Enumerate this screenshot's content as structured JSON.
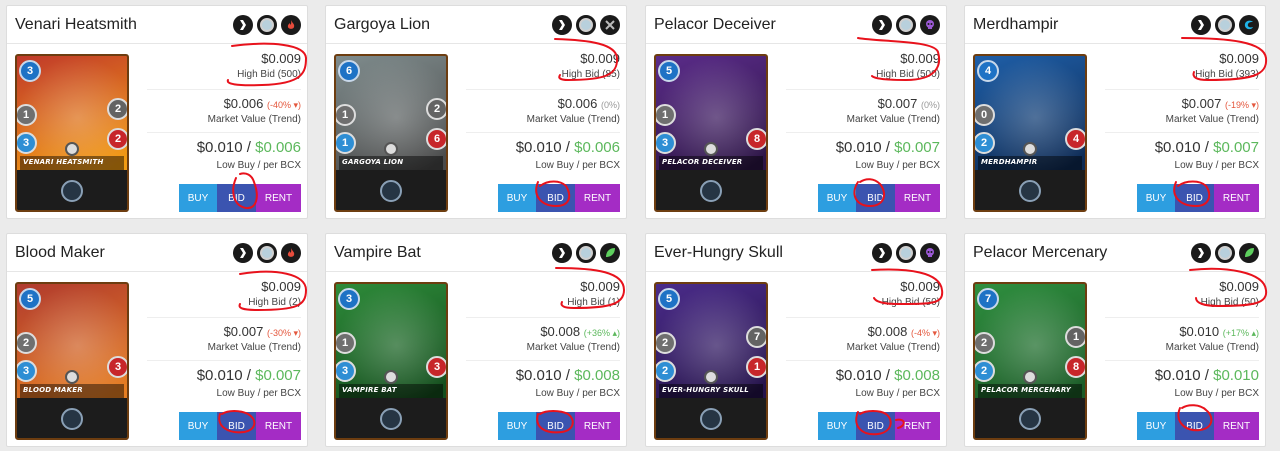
{
  "cards": [
    {
      "name": "Venari Heatsmith",
      "element": "fire",
      "mana": "3",
      "left_stat": "1",
      "speed": "3",
      "armor": "2",
      "health": "2",
      "art_colors": [
        "#c0392b",
        "#f39c12"
      ],
      "high_bid_price": "$0.009",
      "high_bid_label": "High Bid (500)",
      "market_price": "$0.006",
      "market_change": "(-40% ▾)",
      "market_change_type": "neg",
      "market_label": "Market Value (Trend)",
      "low_buy": "$0.010",
      "per_bcx": "$0.006",
      "low_buy_label": "Low Buy / per BCX",
      "buy": "BUY",
      "bid": "BID",
      "rent": "RENT"
    },
    {
      "name": "Gargoya Lion",
      "element": "neutral",
      "mana": "6",
      "left_stat": "1",
      "speed": "1",
      "armor": "2",
      "health": "6",
      "art_colors": [
        "#7f8c8d",
        "#4a4a4a"
      ],
      "high_bid_price": "$0.009",
      "high_bid_label": "High Bid (85)",
      "market_price": "$0.006",
      "market_change": "(0%)",
      "market_change_type": "zero",
      "market_label": "Market Value (Trend)",
      "low_buy": "$0.010",
      "per_bcx": "$0.006",
      "low_buy_label": "Low Buy / per BCX",
      "buy": "BUY",
      "bid": "BID",
      "rent": "RENT"
    },
    {
      "name": "Pelacor Deceiver",
      "element": "death",
      "mana": "5",
      "left_stat": "1",
      "speed": "3",
      "armor": "",
      "health": "8",
      "art_colors": [
        "#5b2c8a",
        "#2c1445"
      ],
      "high_bid_price": "$0.009",
      "high_bid_label": "High Bid (500)",
      "market_price": "$0.007",
      "market_change": "(0%)",
      "market_change_type": "zero",
      "market_label": "Market Value (Trend)",
      "low_buy": "$0.010",
      "per_bcx": "$0.007",
      "low_buy_label": "Low Buy / per BCX",
      "buy": "BUY",
      "bid": "BID",
      "rent": "RENT"
    },
    {
      "name": "Merdhampir",
      "element": "water",
      "mana": "4",
      "left_stat": "0",
      "speed": "2",
      "armor": "",
      "health": "4",
      "art_colors": [
        "#1f5fa8",
        "#0d2a54"
      ],
      "high_bid_price": "$0.009",
      "high_bid_label": "High Bid (393)",
      "market_price": "$0.007",
      "market_change": "(-19% ▾)",
      "market_change_type": "neg",
      "market_label": "Market Value (Trend)",
      "low_buy": "$0.010",
      "per_bcx": "$0.007",
      "low_buy_label": "Low Buy / per BCX",
      "buy": "BUY",
      "bid": "BID",
      "rent": "RENT"
    },
    {
      "name": "Blood Maker",
      "element": "fire",
      "mana": "5",
      "left_stat": "2",
      "speed": "3",
      "armor": "",
      "health": "3",
      "art_colors": [
        "#b03a2e",
        "#e67e22"
      ],
      "high_bid_price": "$0.009",
      "high_bid_label": "High Bid (2)",
      "market_price": "$0.007",
      "market_change": "(-30% ▾)",
      "market_change_type": "neg",
      "market_label": "Market Value (Trend)",
      "low_buy": "$0.010",
      "per_bcx": "$0.007",
      "low_buy_label": "Low Buy / per BCX",
      "buy": "BUY",
      "bid": "BID",
      "rent": "RENT"
    },
    {
      "name": "Vampire Bat",
      "element": "earth",
      "mana": "3",
      "left_stat": "1",
      "speed": "3",
      "armor": "",
      "health": "3",
      "art_colors": [
        "#2e8b3a",
        "#134d1c"
      ],
      "high_bid_price": "$0.009",
      "high_bid_label": "High Bid (1)",
      "market_price": "$0.008",
      "market_change": "(+36% ▴)",
      "market_change_type": "pos",
      "market_label": "Market Value (Trend)",
      "low_buy": "$0.010",
      "per_bcx": "$0.008",
      "low_buy_label": "Low Buy / per BCX",
      "buy": "BUY",
      "bid": "BID",
      "rent": "RENT"
    },
    {
      "name": "Ever-Hungry Skull",
      "element": "death",
      "mana": "5",
      "left_stat": "2",
      "speed": "2",
      "armor": "7",
      "health": "1",
      "art_colors": [
        "#4b2c8a",
        "#24124a"
      ],
      "high_bid_price": "$0.009",
      "high_bid_label": "High Bid (50)",
      "market_price": "$0.008",
      "market_change": "(-4% ▾)",
      "market_change_type": "neg",
      "market_label": "Market Value (Trend)",
      "low_buy": "$0.010",
      "per_bcx": "$0.008",
      "low_buy_label": "Low Buy / per BCX",
      "buy": "BUY",
      "bid": "BID",
      "rent": "RENT"
    },
    {
      "name": "Pelacor Mercenary",
      "element": "earth",
      "mana": "7",
      "left_stat": "2",
      "speed": "2",
      "armor": "1",
      "health": "8",
      "art_colors": [
        "#2f8f3f",
        "#1a5a26"
      ],
      "high_bid_price": "$0.009",
      "high_bid_label": "High Bid (50)",
      "market_price": "$0.010",
      "market_change": "(+17% ▴)",
      "market_change_type": "pos",
      "market_label": "Market Value (Trend)",
      "low_buy": "$0.010",
      "per_bcx": "$0.010",
      "low_buy_label": "Low Buy / per BCX",
      "buy": "BUY",
      "bid": "BID",
      "rent": "RENT"
    }
  ],
  "colors": {
    "buy": "#2d9ee0",
    "bid": "#3b54b0",
    "rent": "#a42cc5",
    "positive": "#5cb85c",
    "negative": "#e4573d",
    "annotation": "#e8121c"
  }
}
